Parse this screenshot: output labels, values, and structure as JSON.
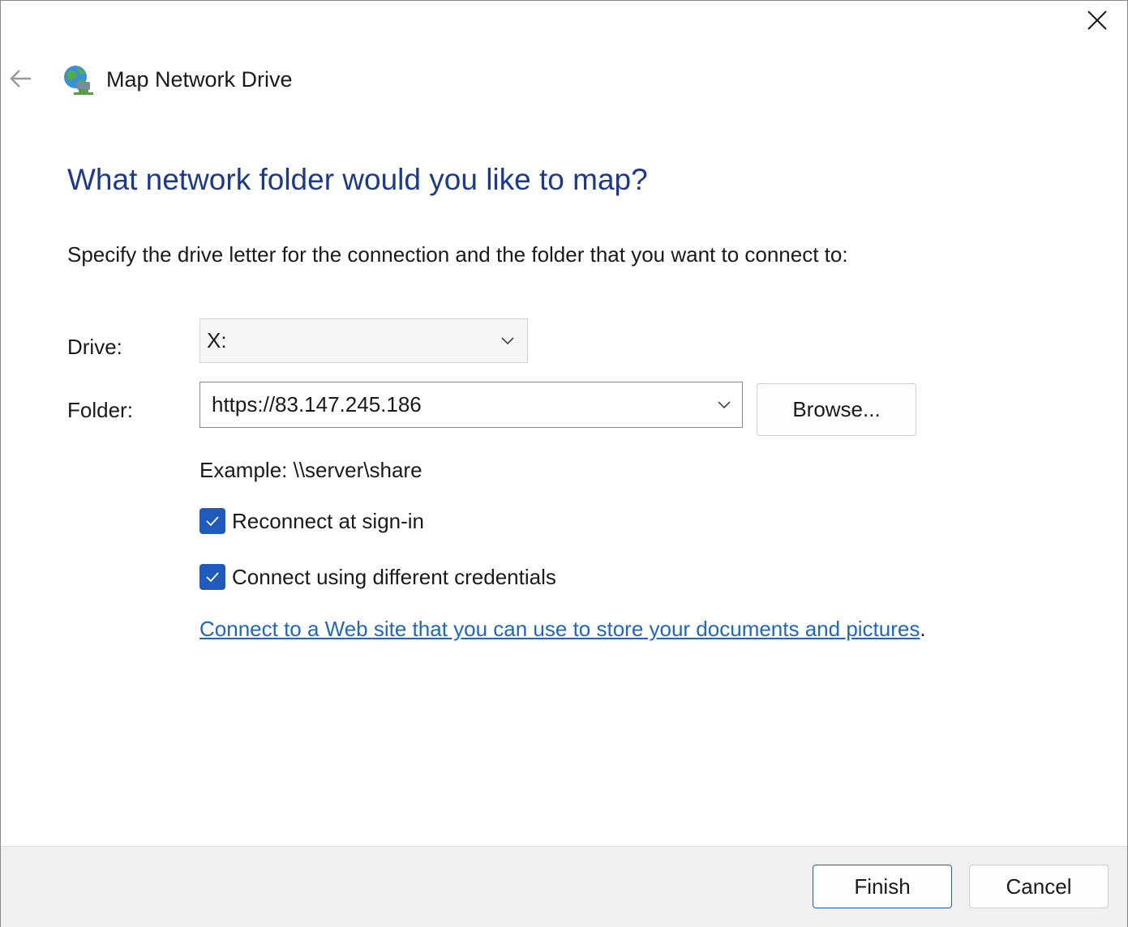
{
  "window": {
    "title": "Map Network Drive"
  },
  "icons": {
    "close": "close-icon",
    "back": "back-arrow-icon",
    "app": "network-drive-icon",
    "dropdown": "chevron-down-icon",
    "check": "checkmark-icon"
  },
  "main": {
    "heading": "What network folder would you like to map?",
    "instructions": "Specify the drive letter for the connection and the folder that you want to connect to:",
    "drive_label": "Drive:",
    "drive_value": "X:",
    "folder_label": "Folder:",
    "folder_value": "https://83.147.245.186",
    "browse_label": "Browse...",
    "example": "Example: \\\\server\\share",
    "reconnect_label": "Reconnect at sign-in",
    "reconnect_checked": true,
    "credentials_label": "Connect using different credentials",
    "credentials_checked": true,
    "web_link": "Connect to a Web site that you can use to store your documents and pictures",
    "web_link_suffix": "."
  },
  "footer": {
    "finish_label": "Finish",
    "cancel_label": "Cancel"
  },
  "colors": {
    "heading": "#1b3a8f",
    "accent": "#1f5bbd",
    "link": "#1f66c2",
    "footer_bg": "#f0f0f0"
  }
}
